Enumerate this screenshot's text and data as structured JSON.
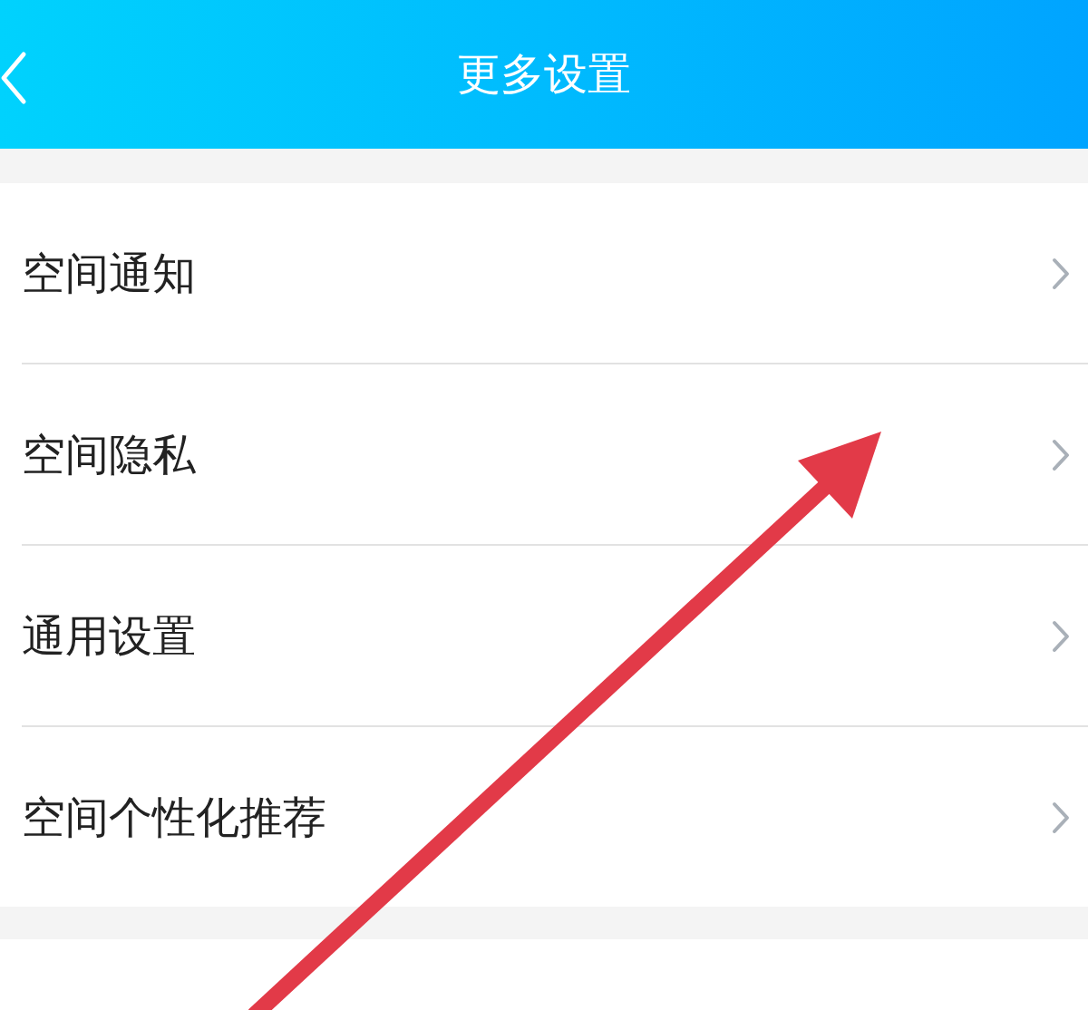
{
  "header": {
    "title": "更多设置"
  },
  "settings": [
    {
      "label": "空间通知"
    },
    {
      "label": "空间隐私"
    },
    {
      "label": "通用设置"
    },
    {
      "label": "空间个性化推荐"
    }
  ]
}
